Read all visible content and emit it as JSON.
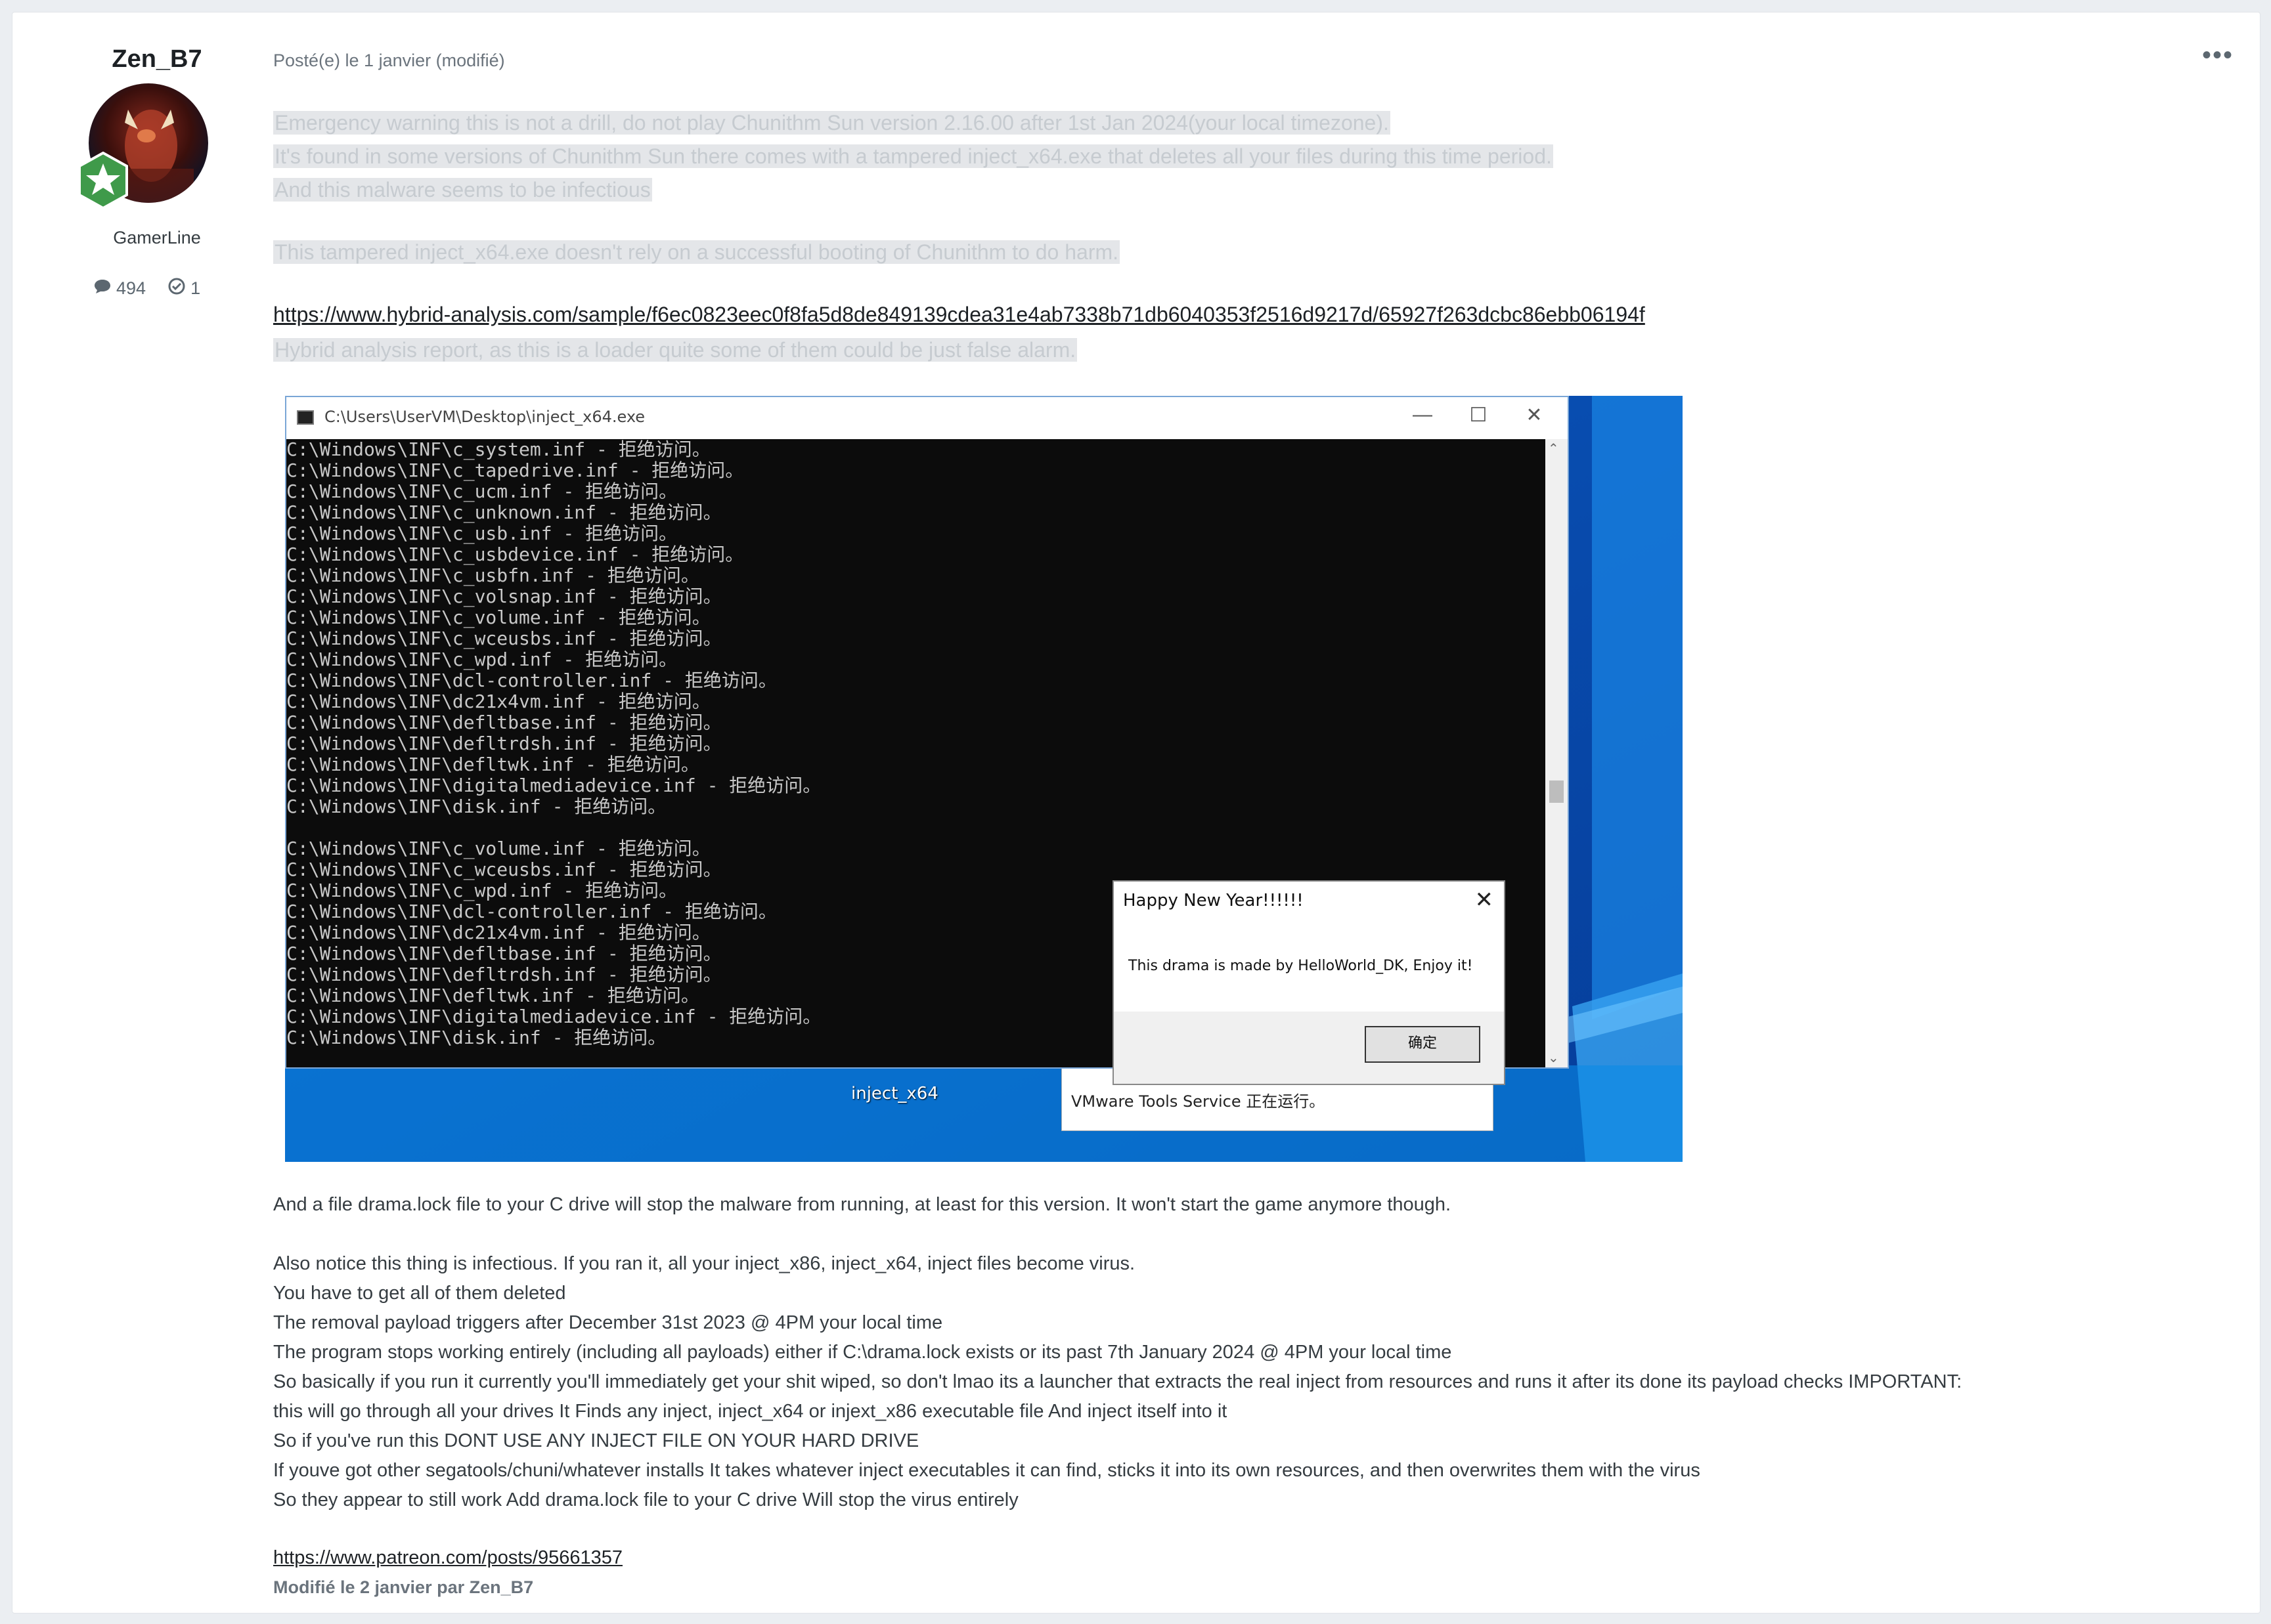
{
  "author": {
    "name": "Zen_B7",
    "group": "GamerLine",
    "posts_count": "494",
    "reputation": "1"
  },
  "post": {
    "meta": "Posté(e) le 1 janvier (modifié)",
    "more_label": "•••",
    "highlighted_lines": [
      "Emergency warning this is not a drill, do not play Chunithm Sun version 2.16.00 after 1st Jan 2024(your local timezone).",
      "It's found in some versions of Chunithm Sun there comes with a tampered inject_x64.exe that deletes all your files during this time period.",
      "And this malware seems to be infectious",
      "This tampered inject_x64.exe doesn't rely on a successful booting of Chunithm to do harm."
    ],
    "analysis_link": "https://www.hybrid-analysis.com/sample/f6ec0823eec0f8fa5d8de849139cdea31e4ab7338b71db6040353f2516d9217d/65927f263dcbc86ebb06194f",
    "analysis_note": "Hybrid analysis report, as this is a loader quite some of them could be just false alarm.",
    "body_lines": [
      "And a file drama.lock file to your C drive will stop the malware from running, at least for this version. It won't start the game anymore though.",
      "Also notice this thing is infectious. If you ran it, all your inject_x86, inject_x64, inject files become virus.",
      "You have to get all of them deleted",
      "The removal payload triggers after December 31st 2023 @ 4PM your local time",
      "The program stops working entirely (including all payloads) either if C:\\drama.lock exists or its past 7th January 2024 @ 4PM your local time",
      "So basically if you run it currently you'll immediately get your shit wiped, so don't lmao its a launcher that extracts the real inject from resources and runs it after its done its payload checks IMPORTANT:",
      "this will go through all your drives It Finds any inject, inject_x64 or injext_x86 executable file And inject itself into it",
      "So if you've run this DONT USE ANY INJECT FILE ON YOUR HARD DRIVE",
      "If youve got other segatools/chuni/whatever installs It takes whatever inject executables it can find, sticks it into its own resources, and then overwrites them with the virus",
      "So they appear to still work Add drama.lock file to your C drive Will stop the virus entirely"
    ],
    "patreon_link": "https://www.patreon.com/posts/95661357",
    "edited_note": "Modifié le 2 janvier par Zen_B7"
  },
  "screenshot": {
    "window_title": "C:\\Users\\UserVM\\Desktop\\inject_x64.exe",
    "console_lines": [
      "C:\\Windows\\INF\\c_system.inf - 拒绝访问。",
      "C:\\Windows\\INF\\c_tapedrive.inf - 拒绝访问。",
      "C:\\Windows\\INF\\c_ucm.inf - 拒绝访问。",
      "C:\\Windows\\INF\\c_unknown.inf - 拒绝访问。",
      "C:\\Windows\\INF\\c_usb.inf - 拒绝访问。",
      "C:\\Windows\\INF\\c_usbdevice.inf - 拒绝访问。",
      "C:\\Windows\\INF\\c_usbfn.inf - 拒绝访问。",
      "C:\\Windows\\INF\\c_volsnap.inf - 拒绝访问。",
      "C:\\Windows\\INF\\c_volume.inf - 拒绝访问。",
      "C:\\Windows\\INF\\c_wceusbs.inf - 拒绝访问。",
      "C:\\Windows\\INF\\c_wpd.inf - 拒绝访问。",
      "C:\\Windows\\INF\\dcl-controller.inf - 拒绝访问。",
      "C:\\Windows\\INF\\dc21x4vm.inf - 拒绝访问。",
      "C:\\Windows\\INF\\defltbase.inf - 拒绝访问。",
      "C:\\Windows\\INF\\defltrdsh.inf - 拒绝访问。",
      "C:\\Windows\\INF\\defltwk.inf - 拒绝访问。",
      "C:\\Windows\\INF\\digitalmediadevice.inf - 拒绝访问。",
      "C:\\Windows\\INF\\disk.inf - 拒绝访问。",
      "",
      "C:\\Windows\\INF\\c_volume.inf - 拒绝访问。",
      "C:\\Windows\\INF\\c_wceusbs.inf - 拒绝访问。",
      "C:\\Windows\\INF\\c_wpd.inf - 拒绝访问。",
      "C:\\Windows\\INF\\dcl-controller.inf - 拒绝访问。",
      "C:\\Windows\\INF\\dc21x4vm.inf - 拒绝访问。",
      "C:\\Windows\\INF\\defltbase.inf - 拒绝访问。",
      "C:\\Windows\\INF\\defltrdsh.inf - 拒绝访问。",
      "C:\\Windows\\INF\\defltwk.inf - 拒绝访问。",
      "C:\\Windows\\INF\\digitalmediadevice.inf - 拒绝访问。",
      "C:\\Windows\\INF\\disk.inf - 拒绝访问。"
    ],
    "dialog_title": "Happy New Year!!!!!!",
    "dialog_message": "This drama is made by HelloWorld_DK, Enjoy it!",
    "dialog_ok": "确定",
    "desktop_icon_label": "inject_x64",
    "service_text": "VMware Tools Service 正在运行。"
  }
}
